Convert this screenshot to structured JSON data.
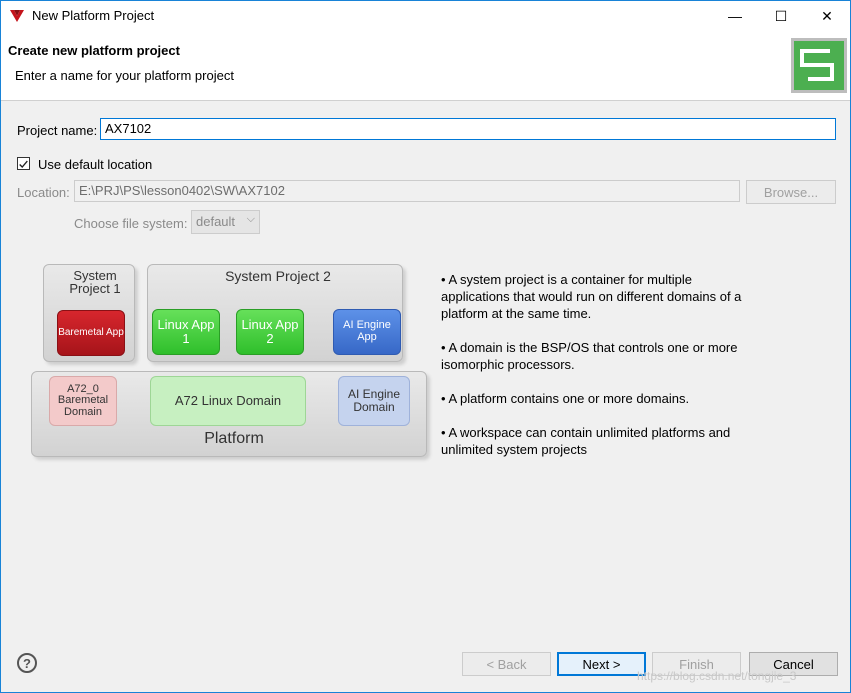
{
  "window": {
    "title": "New Platform Project",
    "minimize_glyph": "—",
    "maximize_glyph": "☐",
    "close_glyph": "✕"
  },
  "header": {
    "title": "Create new platform project",
    "subtitle": "Enter a name for your platform project"
  },
  "form": {
    "project_name_label": "Project name:",
    "project_name_value": "AX7102",
    "use_default_location_label": "Use default location",
    "use_default_location_checked": true,
    "location_label": "Location:",
    "location_value": "E:\\PRJ\\PS\\lesson0402\\SW\\AX7102",
    "browse_label": "Browse...",
    "file_system_label": "Choose file system:",
    "file_system_value": "default"
  },
  "diagram": {
    "system_project_1": "System Project 1",
    "system_project_2": "System Project 2",
    "baremetal_app": "Baremetal App",
    "linux_app_1": "Linux App 1",
    "linux_app_2": "Linux App 2",
    "ai_engine_app": "AI Engine App",
    "a72_baremetal_domain": "A72_0 Baremetal Domain",
    "a72_linux_domain": "A72 Linux Domain",
    "ai_engine_domain": "AI Engine Domain",
    "platform": "Platform"
  },
  "info": [
    "• A system project is a container for multiple applications that would run on different domains of a platform at the same time.",
    "• A domain is the BSP/OS that controls one or more isomorphic processors.",
    "• A platform contains one or more domains.",
    "• A workspace can contain unlimited platforms and unlimited system projects"
  ],
  "buttons": {
    "back": "< Back",
    "next": "Next >",
    "finish": "Finish",
    "cancel": "Cancel",
    "help_glyph": "?"
  },
  "watermark": "https://blog.csdn.net/tongjie_3",
  "colors": {
    "accent": "#0078d7",
    "header_icon": "#4caf50"
  }
}
